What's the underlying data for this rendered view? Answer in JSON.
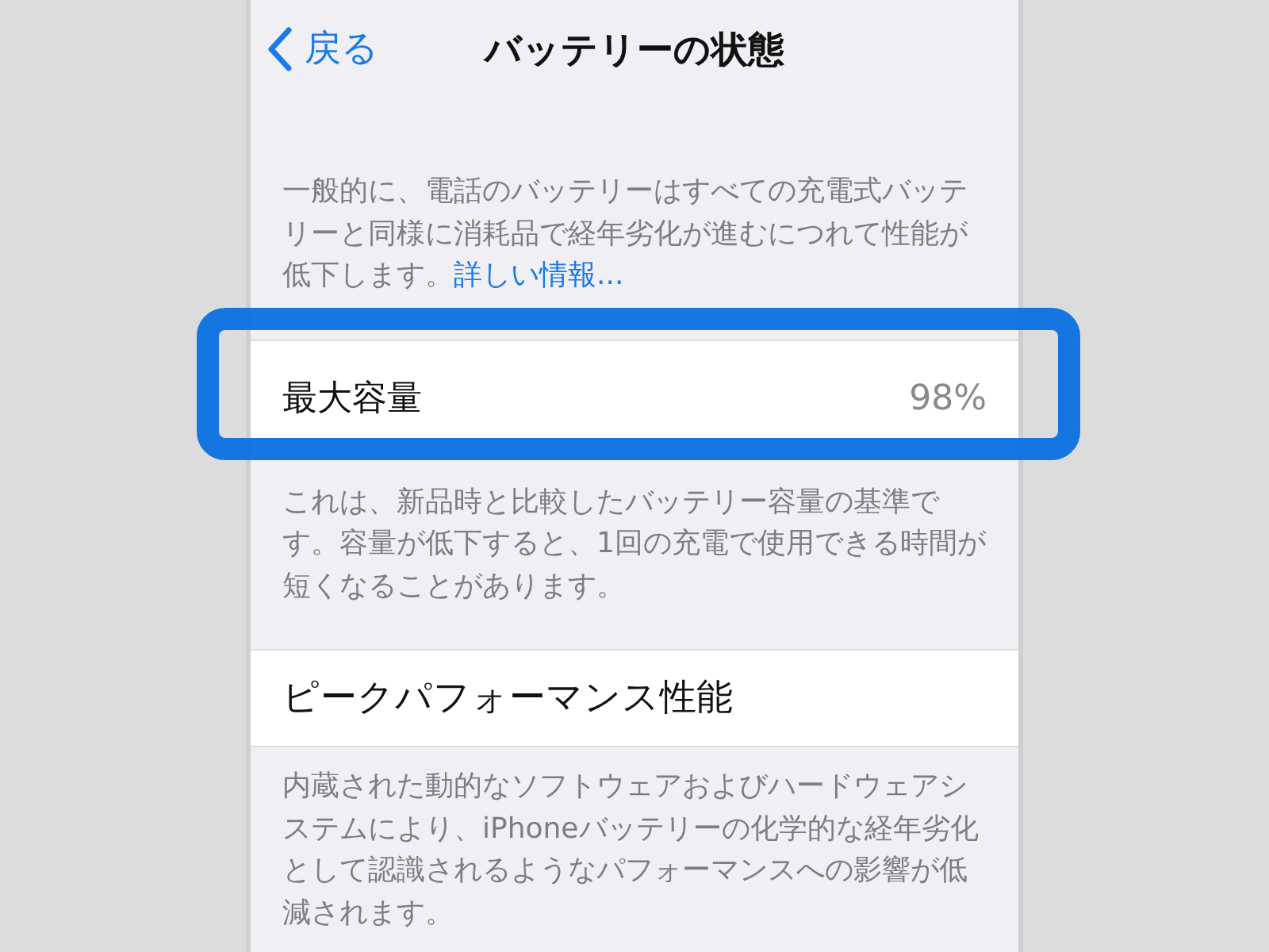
{
  "nav": {
    "back_label": "戻る",
    "title": "バッテリーの状態"
  },
  "intro": {
    "text": "一般的に、電話のバッテリーはすべての充電式バッテリーと同様に消耗品で経年劣化が進むにつれて性能が低下します。",
    "link": "詳しい情報..."
  },
  "maximum_capacity": {
    "label": "最大容量",
    "value": "98%",
    "note": "これは、新品時と比較したバッテリー容量の基準です。容量が低下すると、1回の充電で使用できる時間が短くなることがあります。"
  },
  "peak_performance": {
    "label": "ピークパフォーマンス性能",
    "note": "内蔵された動的なソフトウェアおよびハードウェアシステムにより、iPhoneバッテリーの化学的な経年劣化として認識されるようなパフォーマンスへの影響が低減されます。"
  }
}
